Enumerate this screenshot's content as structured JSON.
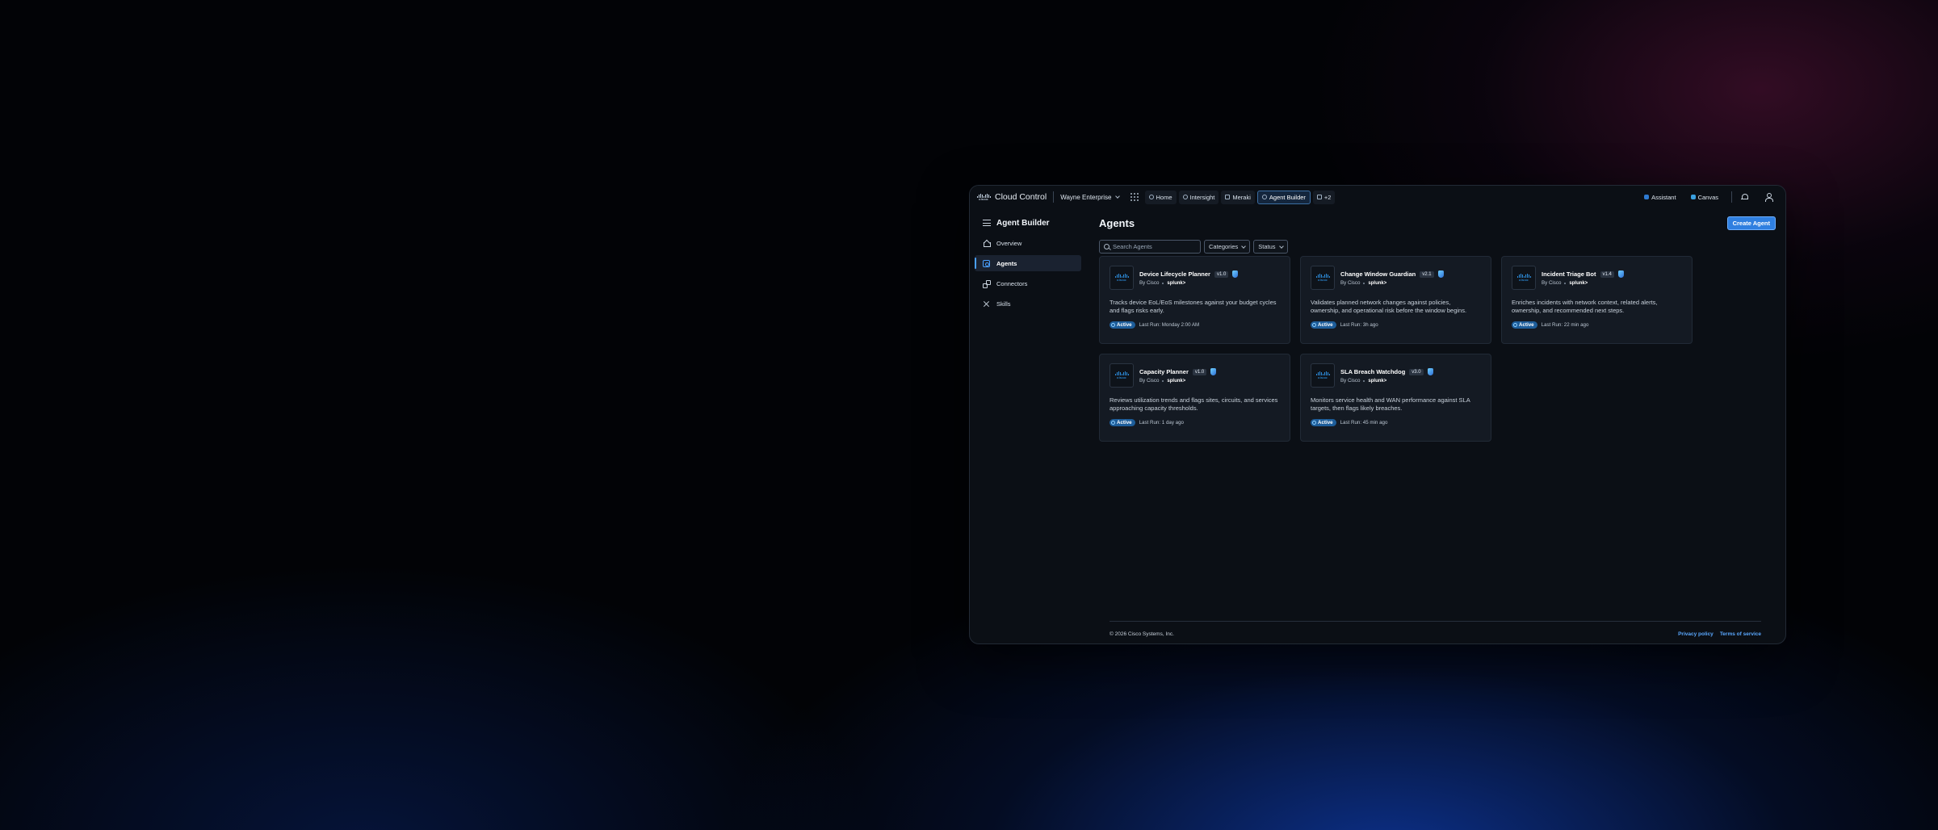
{
  "header": {
    "brand_mark": "cisco",
    "app_title": "Cloud Control",
    "tenant": "Wayne Enterprise",
    "nav": [
      {
        "label": "Home",
        "icon": "home-icon"
      },
      {
        "label": "Intersight",
        "icon": "intersight-icon"
      },
      {
        "label": "Meraki",
        "icon": "meraki-icon"
      },
      {
        "label": "Agent Builder",
        "icon": "agent-builder-icon",
        "active": true
      },
      {
        "label": "+2",
        "icon": "more-icon"
      }
    ],
    "assistant_label": "Assistant",
    "canvas_label": "Canvas"
  },
  "sidebar": {
    "title": "Agent Builder",
    "items": [
      {
        "label": "Overview",
        "icon": "home-icon"
      },
      {
        "label": "Agents",
        "icon": "agent-icon",
        "active": true
      },
      {
        "label": "Connectors",
        "icon": "connectors-icon"
      },
      {
        "label": "Skills",
        "icon": "tools-icon"
      }
    ]
  },
  "main": {
    "title": "Agents",
    "create_label": "Create Agent",
    "search_placeholder": "Search Agents",
    "filters": [
      "Categories",
      "Status"
    ]
  },
  "agents": [
    {
      "name": "Device Lifecycle Planner",
      "version": "v1.0",
      "by": "By Cisco",
      "partner": "splunk>",
      "description": "Tracks device EoL/EoS milestones against your budget cycles and flags risks early.",
      "status": "Active",
      "last_run": "Last Run: Monday 2:00 AM"
    },
    {
      "name": "Change Window Guardian",
      "version": "v2.1",
      "by": "By Cisco",
      "partner": "splunk>",
      "description": "Validates planned network changes against policies, ownership, and operational risk before the window begins.",
      "status": "Active",
      "last_run": "Last Run: 3h ago"
    },
    {
      "name": "Incident Triage Bot",
      "version": "v1.4",
      "by": "By Cisco",
      "partner": "splunk>",
      "description": "Enriches incidents with network context, related alerts, ownership, and recommended next steps.",
      "status": "Active",
      "last_run": "Last Run: 22 min ago"
    },
    {
      "name": "Capacity Planner",
      "version": "v1.0",
      "by": "By Cisco",
      "partner": "splunk>",
      "description": "Reviews utilization trends and flags sites, circuits, and services approaching capacity thresholds.",
      "status": "Active",
      "last_run": "Last Run: 1 day ago"
    },
    {
      "name": "SLA Breach Watchdog",
      "version": "v3.0",
      "by": "By Cisco",
      "partner": "splunk>",
      "description": "Monitors service health and WAN performance against SLA targets, then flags likely breaches.",
      "status": "Active",
      "last_run": "Last Run: 45 min ago"
    }
  ],
  "footer": {
    "copyright": "© 2026 Cisco Systems, Inc.",
    "privacy": "Privacy policy",
    "terms": "Terms of service"
  },
  "colors": {
    "accent": "#2f7fe0",
    "active_badge": "#1d5d9a",
    "window_bg": "#0b0f15",
    "card_bg": "#141a23"
  }
}
